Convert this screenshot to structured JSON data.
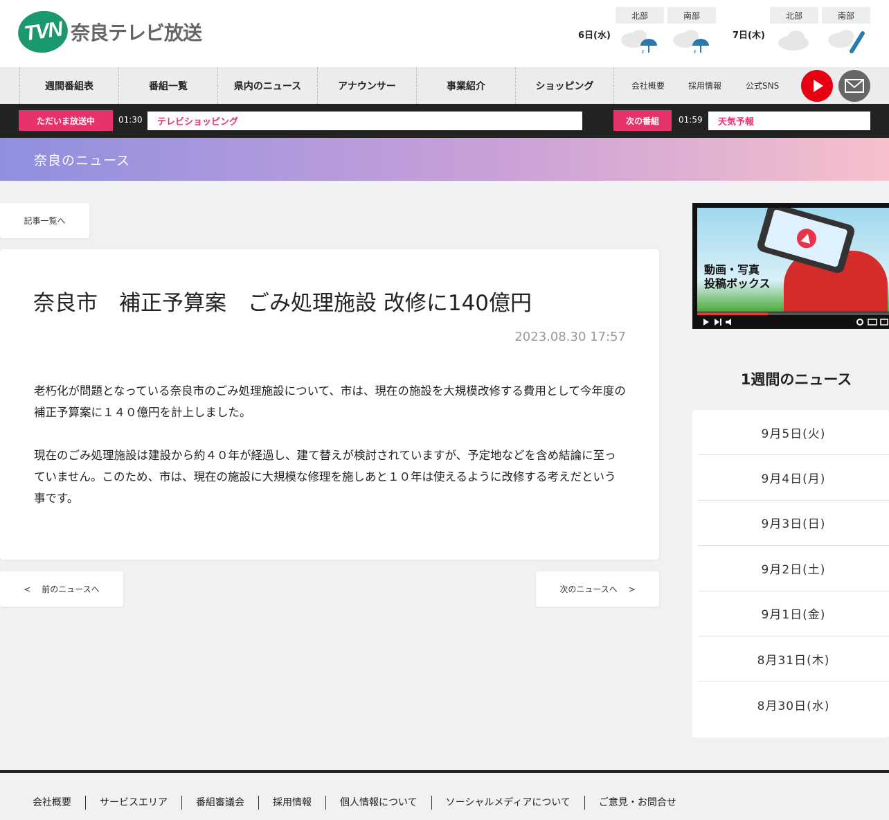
{
  "header": {
    "logo_mark": "TVN",
    "logo_text": "奈良テレビ放送"
  },
  "weather": {
    "days": [
      {
        "label": "6日(水)",
        "north": "北部",
        "south": "南部",
        "north_icon": "cloud-rain-icon",
        "south_icon": "cloud-rain-icon"
      },
      {
        "label": "7日(木)",
        "north": "北部",
        "south": "南部",
        "north_icon": "cloud-icon",
        "south_icon": "cloud-umbrella-icon"
      }
    ]
  },
  "nav": {
    "items": [
      "週間番組表",
      "番組一覧",
      "県内のニュース",
      "アナウンサー",
      "事業紹介",
      "ショッピング"
    ],
    "sub": [
      "会社概要",
      "採用情報",
      "公式SNS"
    ]
  },
  "broadcast": {
    "onair_label": "ただいま放送中",
    "onair_time": "01:30",
    "onair_program": "テレビショッピング",
    "next_label": "次の番組",
    "next_time": "01:59",
    "next_program": "天気予報"
  },
  "banner": {
    "title": "奈良のニュース"
  },
  "main": {
    "back_label": "記事一覧へ",
    "title": "奈良市　補正予算案　ごみ処理施設 改修に140億円",
    "date": "2023.08.30 17:57",
    "paragraphs": [
      "老朽化が問題となっている奈良市のごみ処理施設について、市は、現在の施設を大規模改修する費用として今年度の補正予算案に１４０億円を計上しました。",
      "現在のごみ処理施設は建設から約４０年が経過し、建て替えが検討されていますが、予定地などを含め結論に至っていません。このため、市は、現在の施設に大規模な修理を施しあと１０年は使えるように改修する考えだという事です。"
    ],
    "prev_label": "<　 前のニュースへ",
    "next_label": "次のニュースへ　 >"
  },
  "sidebar": {
    "promo_text_line1": "動画・写真",
    "promo_text_line2": "投稿ボックス",
    "promo_progress": 0.37,
    "week_title": "1週間のニュース",
    "week_items": [
      "9月5日(火)",
      "9月4日(月)",
      "9月3日(日)",
      "9月2日(土)",
      "9月1日(金)",
      "8月31日(木)",
      "8月30日(水)"
    ]
  },
  "footer": {
    "links": [
      "会社概要",
      "サービスエリア",
      "番組審議会",
      "採用情報",
      "個人情報について",
      "ソーシャルメディアについて",
      "ご意見・お問合せ"
    ]
  },
  "colors": {
    "accent_pink": "#e8336a",
    "brand_green": "#1a9a6c",
    "play_red": "#e60012"
  }
}
